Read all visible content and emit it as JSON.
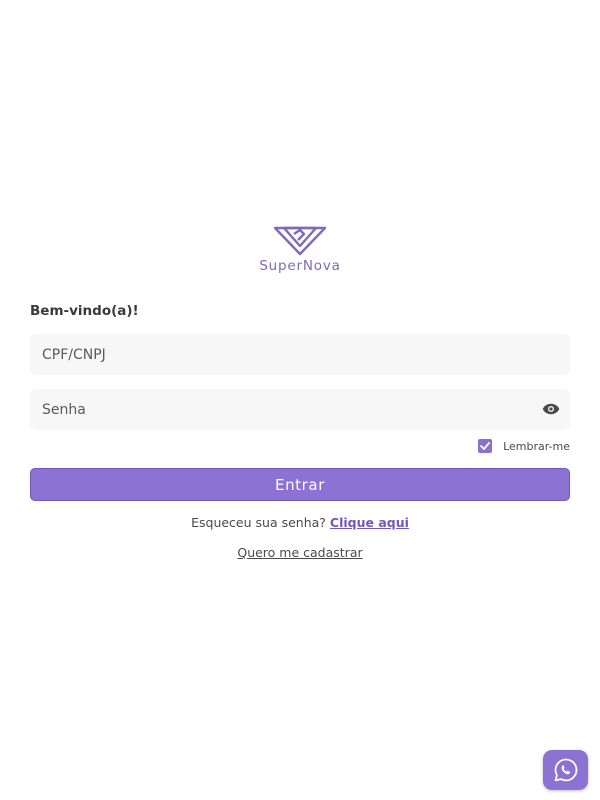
{
  "brand": {
    "name": "SuperNova",
    "logo_icon": "diamond-icon",
    "accent_color": "#8c72d2"
  },
  "login": {
    "welcome": "Bem-vindo(a)!",
    "cpf_placeholder": "CPF/CNPJ",
    "senha_placeholder": "Senha",
    "toggle_icon": "eye-icon",
    "remember_label": "Lembrar-me",
    "remember_checked": true,
    "submit_label": "Entrar",
    "forgot_text": "Esqueceu sua senha?",
    "forgot_link": "Clique aqui",
    "register_link": "Quero me cadastrar"
  },
  "support_button": {
    "icon": "phone-chat-icon"
  }
}
